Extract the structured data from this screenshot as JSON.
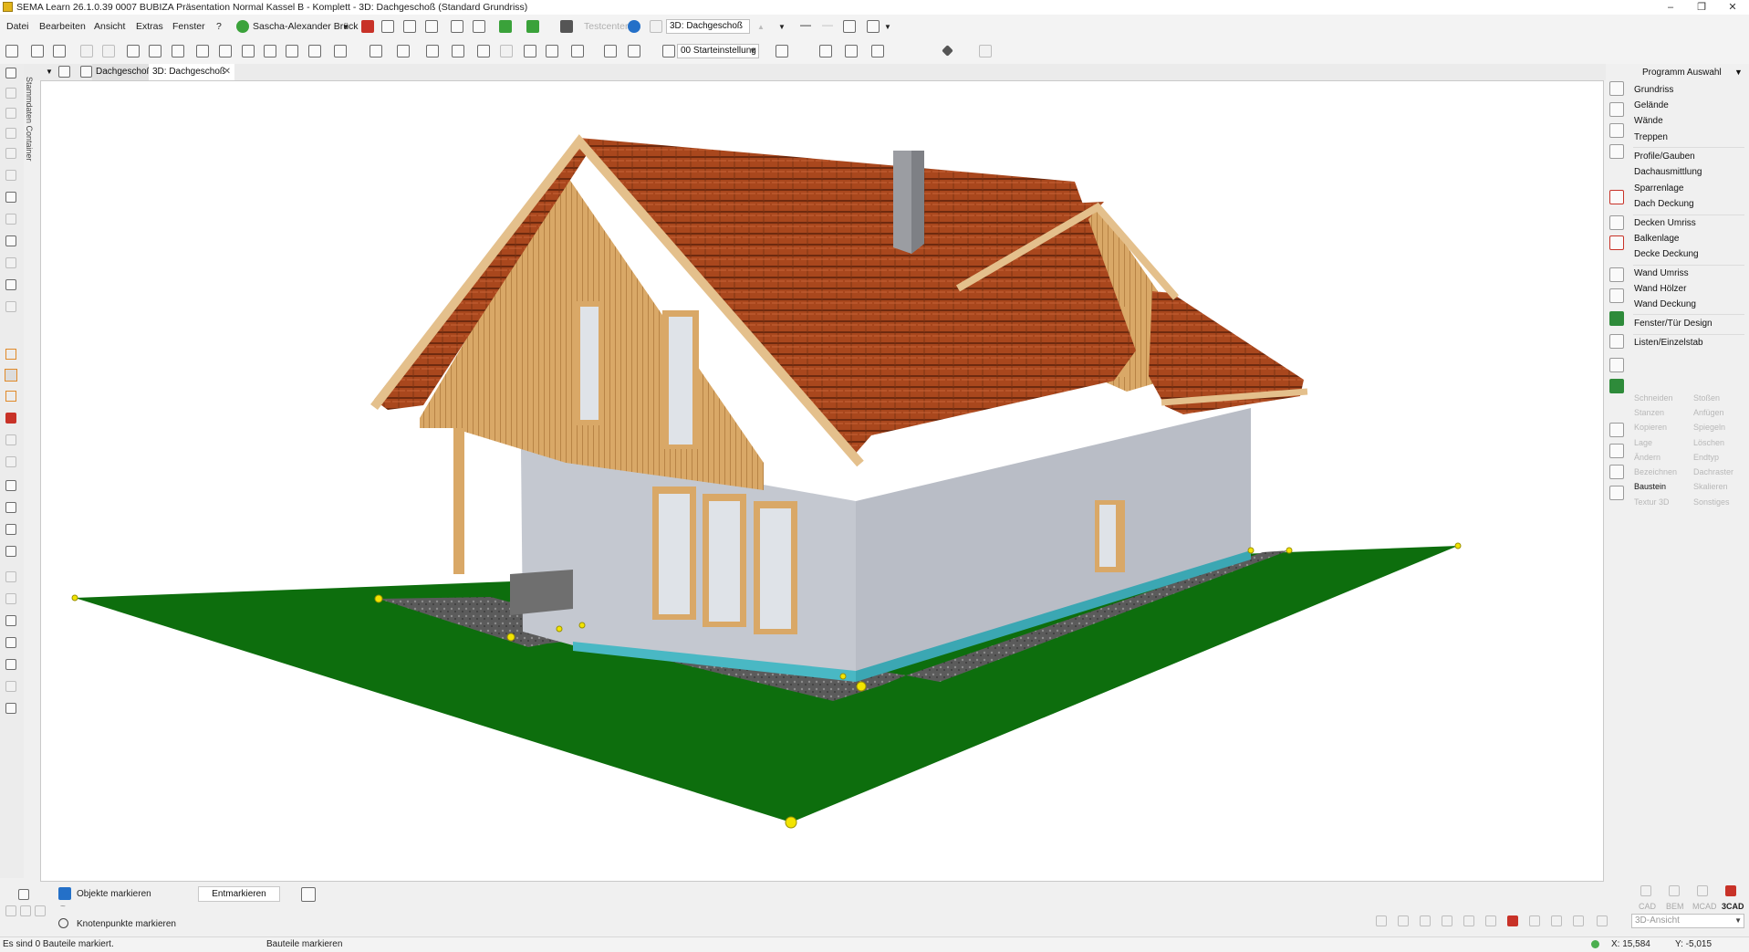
{
  "window": {
    "title": "SEMA Learn  26.1.0.39 0007 BUBIZA Präsentation Normal Kassel B - Komplett  - 3D: Dachgeschoß (Standard Grundriss)",
    "buttons": {
      "minimize": "–",
      "maximize": "❐",
      "close": "✕"
    }
  },
  "menu": {
    "items": [
      "Datei",
      "Bearbeiten",
      "Ansicht",
      "Extras",
      "Fenster",
      "?"
    ],
    "user": "Sascha-Alexander Brück",
    "testcenter": "Testcenter",
    "view_combo": "3D: Dachgeschoß"
  },
  "toolbar": {
    "preset_combo": "00 Starteinstellung"
  },
  "tabs": {
    "items": [
      "Dachgeschoß",
      "3D: Dachgeschoß"
    ],
    "close": "✕"
  },
  "sidebar_label": "Stammdaten Container",
  "right_panel": {
    "header": "Programm Auswahl",
    "items": [
      "Grundriss",
      "Gelände",
      "Wände",
      "Treppen",
      "Profile/Gauben",
      "Dachausmittlung",
      "Sparrenlage",
      "Dach Deckung",
      "Decken Umriss",
      "Balkenlage",
      "Decke Deckung",
      "Wand Umriss",
      "Wand Hölzer",
      "Wand Deckung",
      "Fenster/Tür Design",
      "Listen/Einzelstab"
    ],
    "tools_left": [
      "Schneiden",
      "Stanzen",
      "Kopieren",
      "Lage",
      "Ändern",
      "Bezeichnen",
      "Baustein",
      "Textur 3D"
    ],
    "tools_right": [
      "Stoßen",
      "Anfügen",
      "Spiegeln",
      "Löschen",
      "Endtyp",
      "Dachraster",
      "Skalieren",
      "Sonstiges"
    ]
  },
  "bottom": {
    "mark_objects": "Objekte markieren",
    "mark_nodes": "Knotenpunkte markieren",
    "unmark_button": "Entmarkieren",
    "modes": [
      "CAD",
      "BEM",
      "MCAD",
      "3CAD"
    ],
    "view_combo": "3D-Ansicht"
  },
  "status": {
    "left": "Es sind 0 Bauteile markiert.",
    "middle": "Bauteile markieren",
    "x": "X: 15,584",
    "y": "Y: -5,015"
  },
  "colors": {
    "ground": "#0d6e0d",
    "roof": "#a9471d",
    "wood": "#d9a867",
    "wall": "#c4c8d0",
    "plinth": "#49b8c4",
    "handle": "#f2e400"
  }
}
